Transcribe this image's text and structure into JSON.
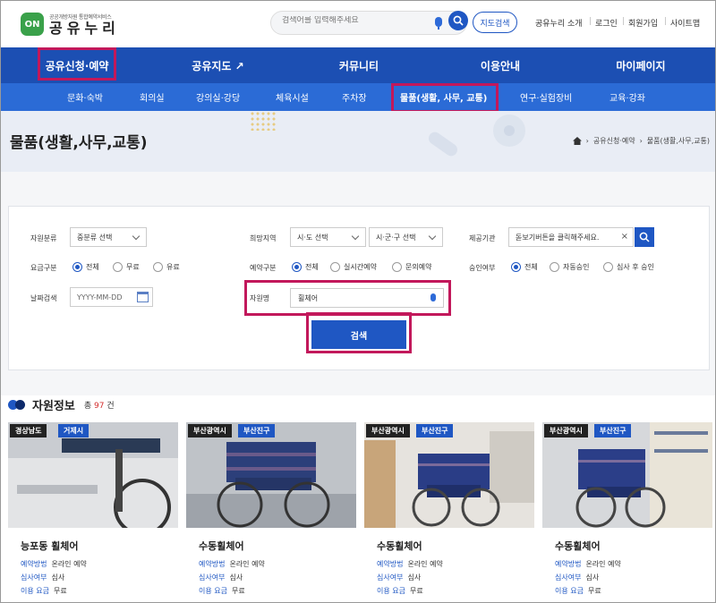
{
  "header": {
    "logo_mark": "ON",
    "logo_sub": "공공개방자원 통합예약서비스",
    "logo_main": "공유누리",
    "search_placeholder": "검색어를 입력해주세요",
    "map_search": "지도검색",
    "util_links": [
      "공유누리 소개",
      "로그인",
      "회원가입",
      "사이트맵"
    ]
  },
  "main_nav": [
    "공유신청·예약",
    "공유지도 ↗",
    "커뮤니티",
    "이용안내",
    "마이페이지"
  ],
  "sub_nav": [
    "문화·숙박",
    "회의실",
    "강의실·강당",
    "체육시설",
    "주차장",
    "물품(생활, 사무, 교통)",
    "연구·실험장비",
    "교육·강좌"
  ],
  "page": {
    "title": "물품(생활,사무,교통)",
    "breadcrumb": [
      "공유신청·예약",
      "물품(생활,사무,교통)"
    ]
  },
  "filters": {
    "category_label": "자원분류",
    "category_value": "중분류 선택",
    "region_label": "희망지역",
    "region_sido": "시·도 선택",
    "region_sigungu": "시·군·구 선택",
    "org_label": "제공기관",
    "org_placeholder": "돋보기버튼을 클릭해주세요.",
    "fee_label": "요금구분",
    "fee_options": [
      "전체",
      "무료",
      "유료"
    ],
    "reserve_label": "예약구분",
    "reserve_options": [
      "전체",
      "실시간예약",
      "문의예약"
    ],
    "approval_label": "승인여부",
    "approval_options": [
      "전체",
      "자동승인",
      "심사 후 승인"
    ],
    "date_label": "날짜검색",
    "date_placeholder": "YYYY-MM-DD",
    "name_label": "자원명",
    "name_value": "휠체어",
    "submit": "검색"
  },
  "resources": {
    "title": "자원정보",
    "count_prefix": "총",
    "count": "97",
    "count_suffix": "건",
    "field_labels": [
      "예약방법",
      "심사여부",
      "이용 요금"
    ],
    "cards": [
      {
        "region": "경상남도",
        "city": "거제시",
        "title": "능포동 휠체어",
        "method": "온라인 예약",
        "review": "심사",
        "fee": "무료"
      },
      {
        "region": "부산광역시",
        "city": "부산진구",
        "title": "수동휠체어",
        "method": "온라인 예약",
        "review": "심사",
        "fee": "무료"
      },
      {
        "region": "부산광역시",
        "city": "부산진구",
        "title": "수동휠체어",
        "method": "온라인 예약",
        "review": "심사",
        "fee": "무료"
      },
      {
        "region": "부산광역시",
        "city": "부산진구",
        "title": "수동휠체어",
        "method": "온라인 예약",
        "review": "심사",
        "fee": "무료"
      }
    ]
  },
  "colors": {
    "primary": "#1c4fb3",
    "subnav": "#2b6bd6",
    "highlight": "#c2185b",
    "count": "#d32f2f"
  }
}
